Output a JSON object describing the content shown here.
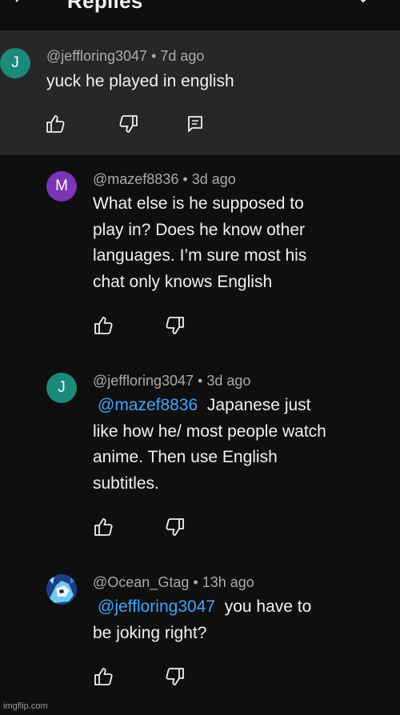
{
  "header": {
    "title": "Replies"
  },
  "colors": {
    "background": "#0f0f0f",
    "highlight": "#272727",
    "mention": "#3ea6ff",
    "meta": "#aaaaaa"
  },
  "parent_comment": {
    "avatar_letter": "J",
    "avatar_color": "#1b8a7a",
    "author": "@jeffloring3047",
    "time": "7d ago",
    "text": "yuck he played in english"
  },
  "replies": [
    {
      "avatar_letter": "M",
      "avatar_color": "#7b34b5",
      "author": "@mazef8836",
      "time": "3d ago",
      "lines": [
        "What else is he supposed to",
        "play in? Does he know other",
        "languages. I’m sure most his",
        "chat only knows English"
      ]
    },
    {
      "avatar_letter": "J",
      "avatar_color": "#1b8a7a",
      "author": "@jeffloring3047",
      "time": "3d ago",
      "mention": "@mazef8836",
      "first_line_rest": "Japanese just",
      "lines": [
        "like how he/ most people watch",
        "anime. Then use English",
        "subtitles."
      ]
    },
    {
      "avatar_image": "anime-character-avatar",
      "author": "@Ocean_Gtag",
      "time": "13h ago",
      "mention": "@jeffloring3047",
      "first_line_rest": "you have to",
      "lines": [
        "be joking right?"
      ]
    }
  ],
  "separator": "•",
  "watermark": "imgflip.com"
}
